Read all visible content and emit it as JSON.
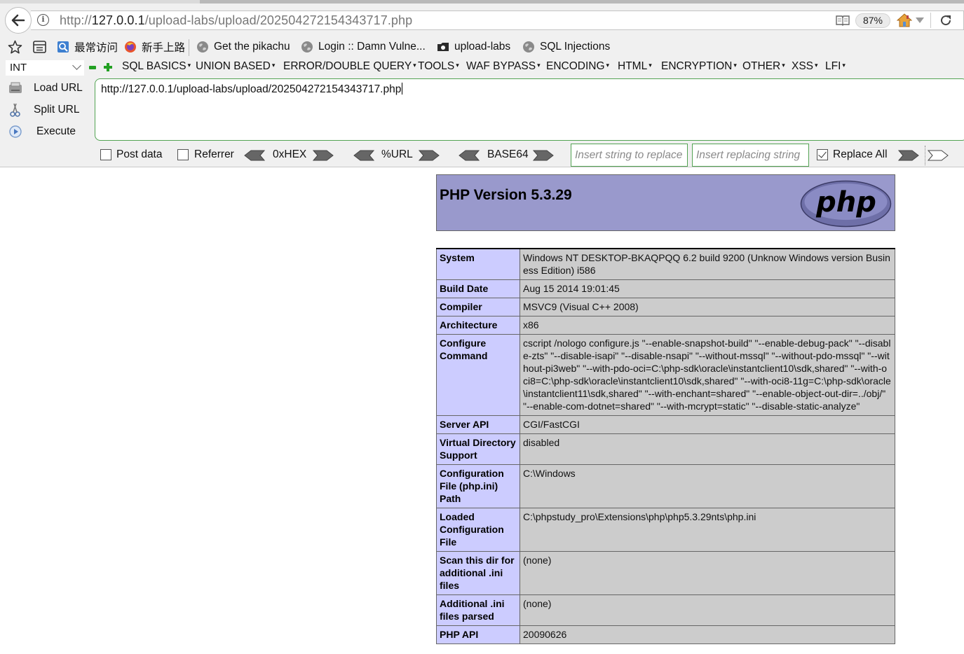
{
  "browser": {
    "url_prefix": "http://",
    "url_host": "127.0.0.1",
    "url_path": "/upload-labs/upload/202504272154343717.php",
    "zoom": "87%"
  },
  "bookmarks": [
    {
      "label": "最常访问",
      "icon": "frequent-icon"
    },
    {
      "label": "新手上路",
      "icon": "firefox-icon"
    },
    {
      "label": "Get the pikachu",
      "icon": "globe-icon"
    },
    {
      "label": "Login :: Damn Vulne...",
      "icon": "globe-icon"
    },
    {
      "label": "upload-labs",
      "icon": "folder-icon"
    },
    {
      "label": "SQL Injections",
      "icon": "globe-icon"
    }
  ],
  "hackbar": {
    "type_select": "INT",
    "menu": [
      "SQL BASICS",
      "UNION BASED",
      "ERROR/DOUBLE QUERY",
      "TOOLS",
      "WAF BYPASS",
      "ENCODING",
      "HTML",
      "ENCRYPTION",
      "OTHER",
      "XSS",
      "LFI"
    ],
    "actions": {
      "load": "Load URL",
      "split": "Split URL",
      "execute": "Execute"
    },
    "url_value": "http://127.0.0.1/upload-labs/upload/202504272154343717.php",
    "post_data": "Post data",
    "referrer": "Referrer",
    "hex": "0xHEX",
    "urlenc": "%URL",
    "base64": "BASE64",
    "replace_placeholder": "Insert string to replace",
    "replacing_placeholder": "Insert replacing string",
    "replace_all": "Replace All"
  },
  "phpinfo": {
    "title": "PHP Version 5.3.29",
    "logo": "php",
    "rows": [
      {
        "key": "System",
        "value": "Windows NT DESKTOP-BKAQPQQ 6.2 build 9200 (Unknow Windows version Business Edition) i586"
      },
      {
        "key": "Build Date",
        "value": "Aug 15 2014 19:01:45"
      },
      {
        "key": "Compiler",
        "value": "MSVC9 (Visual C++ 2008)"
      },
      {
        "key": "Architecture",
        "value": "x86"
      },
      {
        "key": "Configure Command",
        "value": "cscript /nologo configure.js \"--enable-snapshot-build\" \"--enable-debug-pack\" \"--disable-zts\" \"--disable-isapi\" \"--disable-nsapi\" \"--without-mssql\" \"--without-pdo-mssql\" \"--without-pi3web\" \"--with-pdo-oci=C:\\php-sdk\\oracle\\instantclient10\\sdk,shared\" \"--with-oci8=C:\\php-sdk\\oracle\\instantclient10\\sdk,shared\" \"--with-oci8-11g=C:\\php-sdk\\oracle\\instantclient11\\sdk,shared\" \"--with-enchant=shared\" \"--enable-object-out-dir=../obj/\" \"--enable-com-dotnet=shared\" \"--with-mcrypt=static\" \"--disable-static-analyze\""
      },
      {
        "key": "Server API",
        "value": "CGI/FastCGI"
      },
      {
        "key": "Virtual Directory Support",
        "value": "disabled"
      },
      {
        "key": "Configuration File (php.ini) Path",
        "value": "C:\\Windows"
      },
      {
        "key": "Loaded Configuration File",
        "value": "C:\\phpstudy_pro\\Extensions\\php\\php5.3.29nts\\php.ini"
      },
      {
        "key": "Scan this dir for additional .ini files",
        "value": "(none)"
      },
      {
        "key": "Additional .ini files parsed",
        "value": "(none)"
      },
      {
        "key": "PHP API",
        "value": "20090626"
      }
    ]
  }
}
